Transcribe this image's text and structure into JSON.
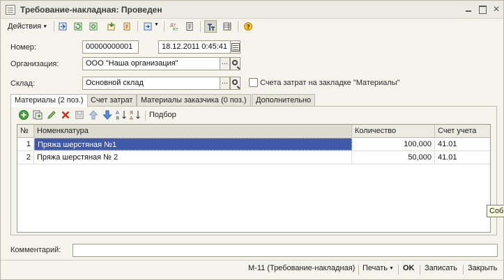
{
  "window": {
    "title": "Требование-накладная: Проведен"
  },
  "toolbar": {
    "actions_label": "Действия"
  },
  "form": {
    "number_label": "Номер:",
    "number_value": "00000000001",
    "date_value": "18.12.2011  0:45:41",
    "organization_label": "Организация:",
    "organization_value": "ООО \"Наша организация\"",
    "warehouse_label": "Склад:",
    "warehouse_value": "Основной склад",
    "cost_accounts_checkbox_label": "Счета затрат на закладке \"Материалы\"",
    "field_button_dots": "..."
  },
  "tabs": [
    {
      "label": "Материалы (2 поз.)"
    },
    {
      "label": "Счет затрат"
    },
    {
      "label": "Материалы заказчика (0 поз.)"
    },
    {
      "label": "Дополнительно"
    }
  ],
  "panel": {
    "pick_label": "Подбор"
  },
  "table": {
    "columns": [
      "№",
      "Номенклатура",
      "Количество",
      "Счет учета"
    ],
    "rows": [
      {
        "n": "1",
        "name": "Пряжа шерстяная №1",
        "qty": "100,000",
        "account": "41.01"
      },
      {
        "n": "2",
        "name": "Пряжа шерстяная № 2",
        "qty": "50,000",
        "account": "41.01"
      }
    ]
  },
  "comment": {
    "label": "Комментарий:",
    "value": ""
  },
  "footer": {
    "print_form_label": "М-11 (Требование-накладная)",
    "print_label": "Печать",
    "ok_label": "OK",
    "save_label": "Записать",
    "close_label": "Закрыть"
  },
  "tooltip": {
    "text": "Собо"
  },
  "colors": {
    "selection": "#3f58a7",
    "window_bg": "#f4f3ec"
  }
}
